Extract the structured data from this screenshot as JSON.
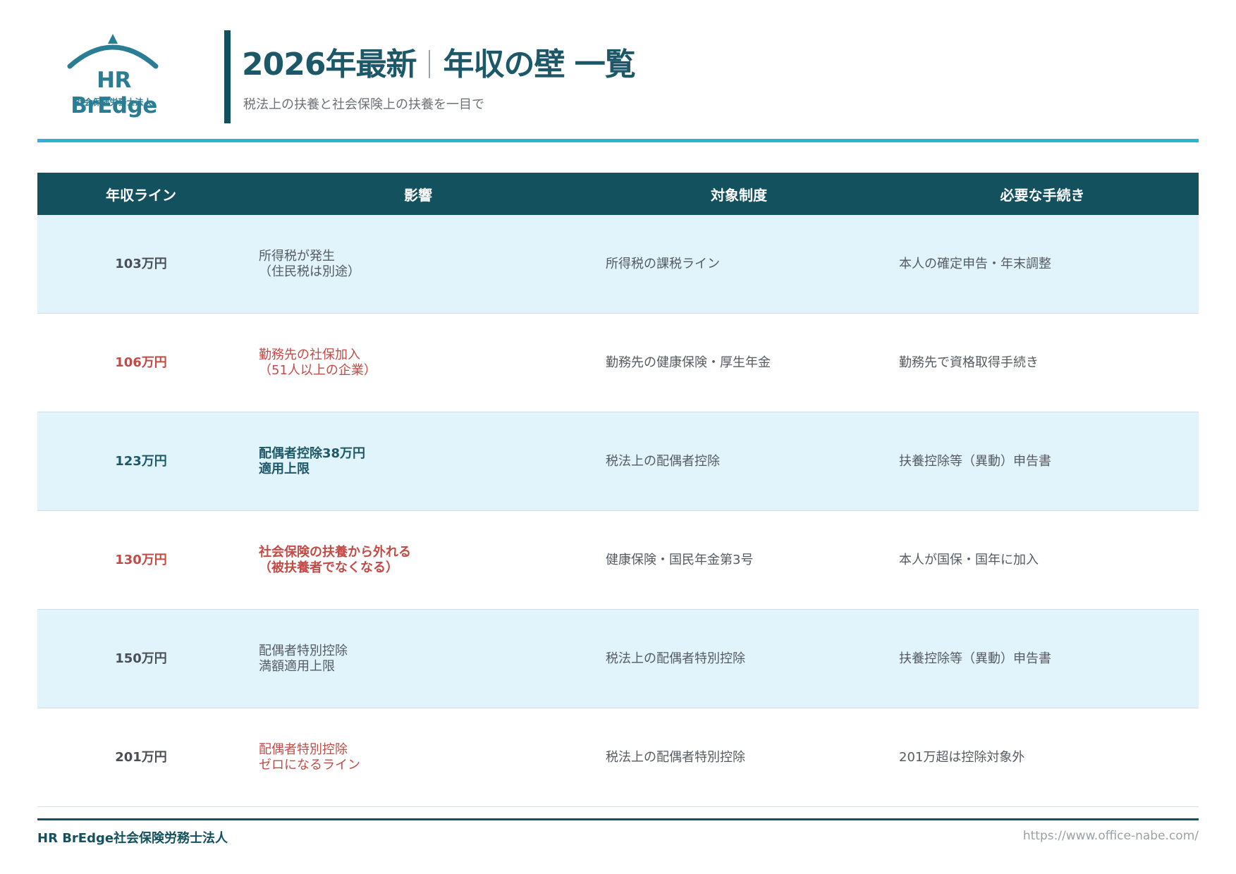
{
  "logo": {
    "name": "HR BrEdge",
    "sub": "社会保険労務士法人",
    "color": "#2b7d93"
  },
  "header": {
    "title_left": "2026年最新",
    "title_right": "年収の壁 一覧",
    "subtitle": "税法上の扶養と社会保険上の扶養を一目で",
    "accent_color": "#30b1d6",
    "bar_color": "#14515f"
  },
  "table": {
    "columns": [
      "年収ライン",
      "影響",
      "対象制度",
      "必要な手続き"
    ],
    "rows": [
      {
        "line": "103万円",
        "impact": "所得税が発生\n（住民税は別途）",
        "system": "所得税の課税ライン",
        "procedure": "本人の確定申告・年末調整",
        "style": "normal"
      },
      {
        "line": "106万円",
        "impact": "勤務先の社保加入\n（51人以上の企業）",
        "system": "勤務先の健康保険・厚生年金",
        "procedure": "勤務先で資格取得手続き",
        "style": "red"
      },
      {
        "line": "123万円",
        "impact": "配偶者控除38万円\n適用上限",
        "system": "税法上の配偶者控除",
        "procedure": "扶養控除等（異動）申告書",
        "style": "teal-bold"
      },
      {
        "line": "130万円",
        "impact": "社会保険の扶養から外れる\n（被扶養者でなくなる）",
        "system": "健康保険・国民年金第3号",
        "procedure": "本人が国保・国年に加入",
        "style": "red-bold"
      },
      {
        "line": "150万円",
        "impact": "配偶者特別控除\n満額適用上限",
        "system": "税法上の配偶者特別控除",
        "procedure": "扶養控除等（異動）申告書",
        "style": "normal"
      },
      {
        "line": "201万円",
        "impact": "配偶者特別控除\nゼロになるライン",
        "system": "税法上の配偶者特別控除",
        "procedure": "201万超は控除対象外",
        "style": "red-light"
      }
    ]
  },
  "footer": {
    "company": "HR BrEdge社会保険労務士法人",
    "url": "https://www.office-nabe.com/"
  }
}
